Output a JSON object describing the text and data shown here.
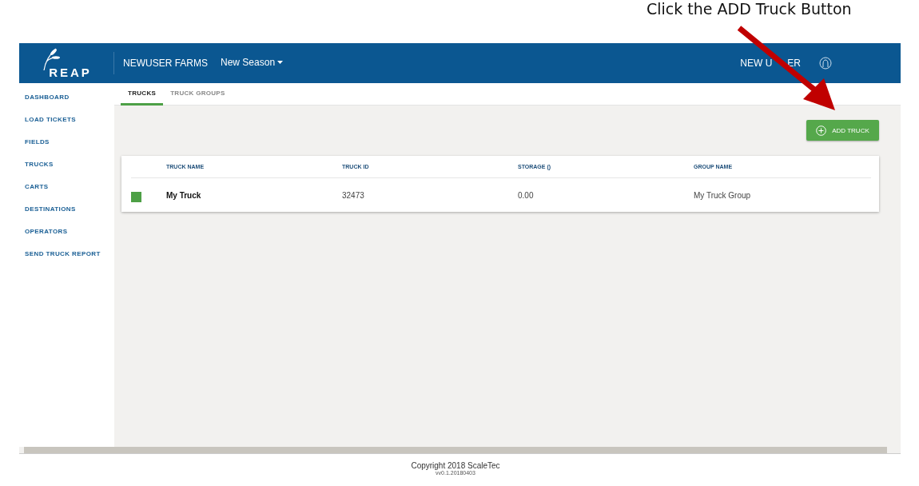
{
  "annotation": {
    "text": "Click the ADD Truck Button"
  },
  "header": {
    "logo": "REAP",
    "farm": "NEWUSER FARMS",
    "season": "New Season",
    "user_parts": [
      "NEW U",
      "ER"
    ]
  },
  "sidebar": {
    "items": [
      {
        "label": "DASHBOARD"
      },
      {
        "label": "LOAD TICKETS"
      },
      {
        "label": "FIELDS"
      },
      {
        "label": "TRUCKS"
      },
      {
        "label": "CARTS"
      },
      {
        "label": "DESTINATIONS"
      },
      {
        "label": "OPERATORS"
      },
      {
        "label": "SEND TRUCK REPORT"
      }
    ]
  },
  "tabs": [
    {
      "label": "TRUCKS",
      "selected": true
    },
    {
      "label": "TRUCK GROUPS",
      "selected": false
    }
  ],
  "add_button": "ADD TRUCK",
  "table": {
    "columns": [
      "TRUCK NAME",
      "TRUCK ID",
      "STORAGE ()",
      "GROUP NAME"
    ],
    "rows": [
      {
        "color": "#4da046",
        "cells": [
          "My Truck",
          "32473",
          "0.00",
          "My Truck Group"
        ]
      }
    ]
  },
  "footer": {
    "copyright": "Copyright 2018 ScaleTec",
    "version": "vv0.1.20180403"
  }
}
